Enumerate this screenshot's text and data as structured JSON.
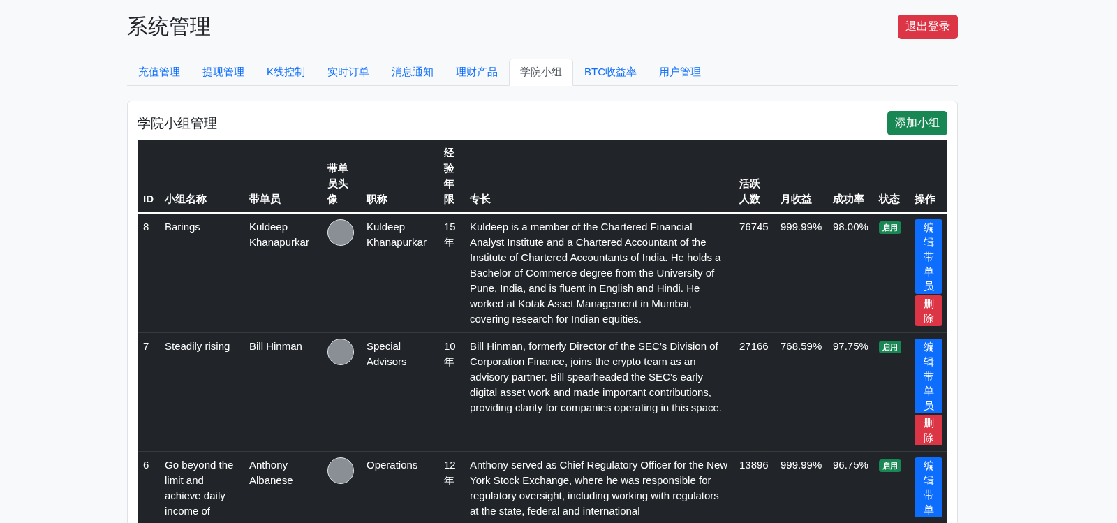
{
  "header": {
    "title": "系统管理",
    "logout_button": "退出登录"
  },
  "tabs": [
    {
      "label": "充值管理",
      "selected": false
    },
    {
      "label": "提现管理",
      "selected": false
    },
    {
      "label": "K线控制",
      "selected": false
    },
    {
      "label": "实时订单",
      "selected": false
    },
    {
      "label": "消息通知",
      "selected": false
    },
    {
      "label": "理财产品",
      "selected": false
    },
    {
      "label": "学院小组",
      "selected": true
    },
    {
      "label": "BTC收益率",
      "selected": false
    },
    {
      "label": "用户管理",
      "selected": false
    }
  ],
  "panel": {
    "title": "学院小组管理",
    "add_button": "添加小组"
  },
  "table": {
    "columns": [
      "ID",
      "小组名称",
      "带单员",
      "带单员头像",
      "职称",
      "经验年限",
      "专长",
      "活跃人数",
      "月收益",
      "成功率",
      "状态",
      "操作"
    ],
    "rows": [
      {
        "id": "8",
        "group_name": "Barings",
        "leader": "Kuldeep Khanapurkar",
        "title": "Kuldeep Khanapurkar",
        "years": "15年",
        "specialty": "Kuldeep is a member of the Chartered Financial Analyst Institute and a Chartered Accountant of the Institute of Chartered Accountants of India. He holds a Bachelor of Commerce degree from the University of Pune, India, and is fluent in English and Hindi. He worked at Kotak Asset Management in Mumbai, covering research for Indian equities.",
        "active_users": "76745",
        "monthly_return": "999.99%",
        "success_rate": "98.00%",
        "status": "启用",
        "actions": [
          {
            "kind": "edit",
            "label": "编辑带单员"
          },
          {
            "kind": "delete",
            "label": "删除"
          }
        ]
      },
      {
        "id": "7",
        "group_name": "Steadily rising",
        "leader": "Bill Hinman",
        "title": "Special Advisors",
        "years": "10年",
        "specialty": "Bill Hinman, formerly Director of the SEC’s Division of Corporation Finance, joins the crypto team as an advisory partner. Bill spearheaded the SEC’s early digital asset work and made important contributions, providing clarity for companies operating in this space.",
        "active_users": "27166",
        "monthly_return": "768.59%",
        "success_rate": "97.75%",
        "status": "启用",
        "actions": [
          {
            "kind": "edit",
            "label": "编辑带单员"
          },
          {
            "kind": "delete",
            "label": "删除"
          }
        ]
      },
      {
        "id": "6",
        "group_name": "Go beyond the limit and achieve daily income of",
        "leader": "Anthony Albanese",
        "title": "Operations",
        "years": "12年",
        "specialty": "Anthony served as Chief Regulatory Officer for the New York Stock Exchange, where he was responsible for regulatory oversight, including working with regulators at the state, federal and international",
        "active_users": "13896",
        "monthly_return": "999.99%",
        "success_rate": "96.75%",
        "status": "启用",
        "actions": [
          {
            "kind": "edit",
            "label": "编辑带单"
          }
        ]
      }
    ]
  }
}
